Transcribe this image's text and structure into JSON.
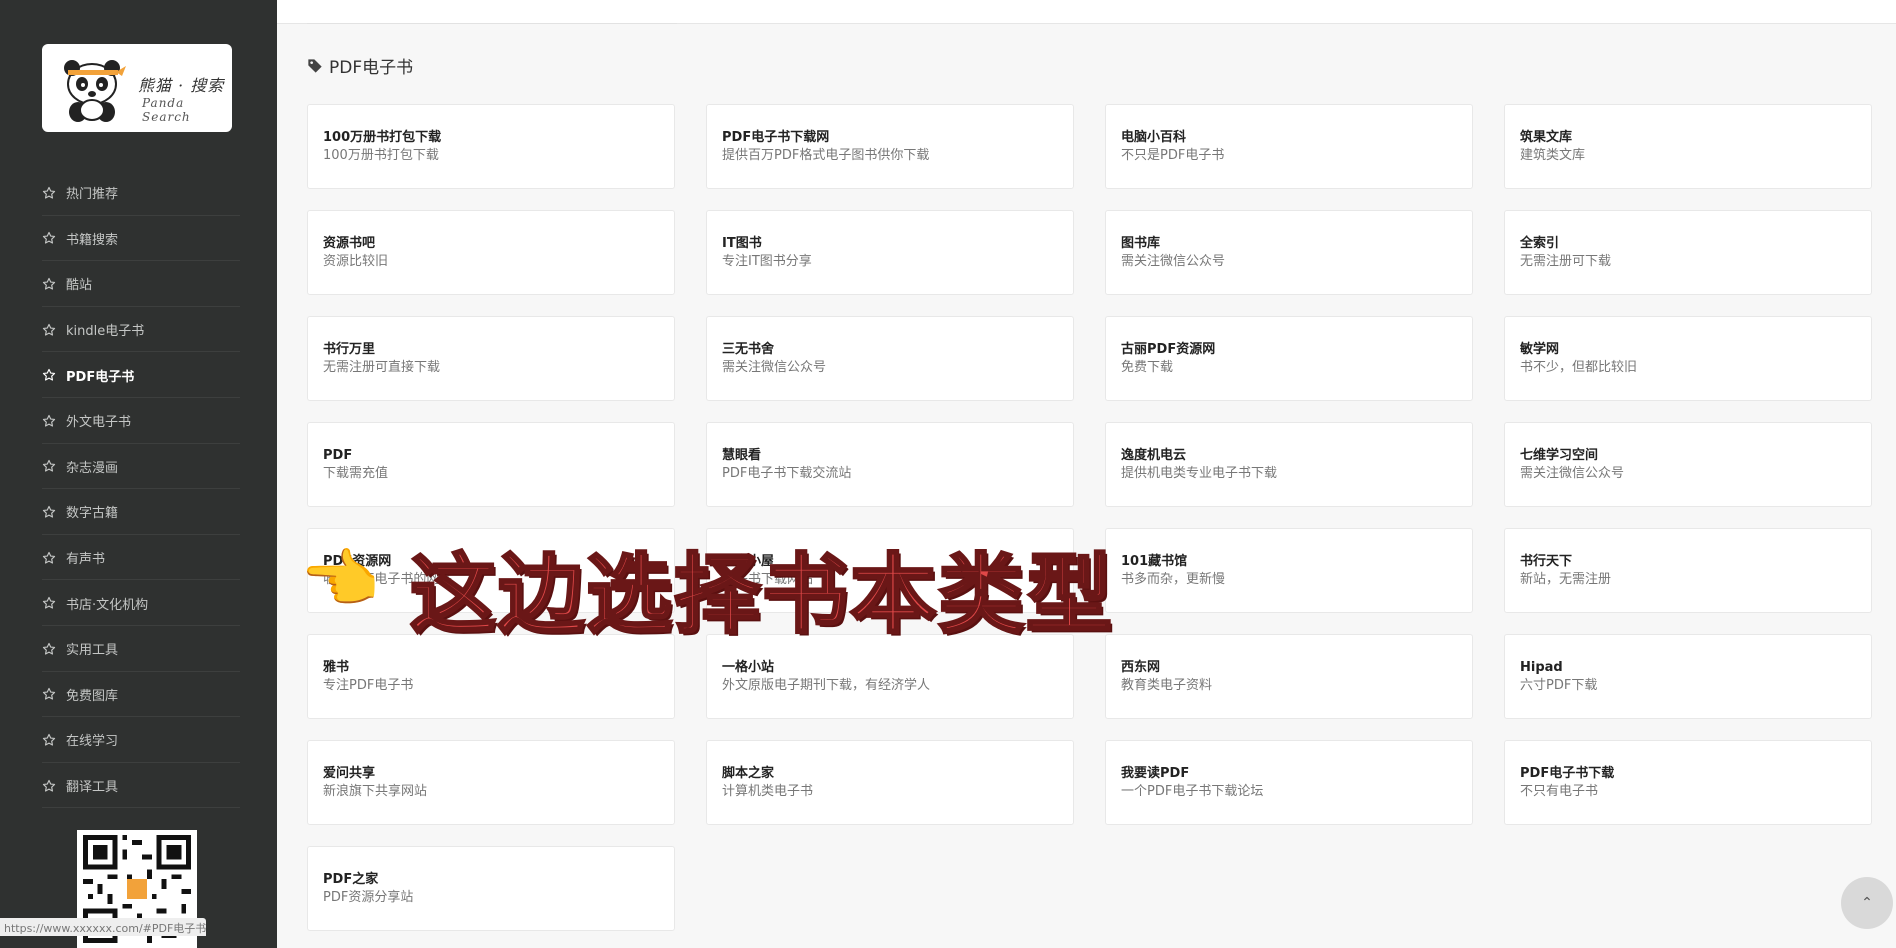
{
  "logo": {
    "title": "熊猫 · 搜索",
    "subtitle": "Panda Search"
  },
  "sidebar": {
    "items": [
      {
        "label": "热门推荐",
        "active": false
      },
      {
        "label": "书籍搜索",
        "active": false
      },
      {
        "label": "酷站",
        "active": false
      },
      {
        "label": "kindle电子书",
        "active": false
      },
      {
        "label": "PDF电子书",
        "active": true
      },
      {
        "label": "外文电子书",
        "active": false
      },
      {
        "label": "杂志漫画",
        "active": false
      },
      {
        "label": "数字古籍",
        "active": false
      },
      {
        "label": "有声书",
        "active": false
      },
      {
        "label": "书店·文化机构",
        "active": false
      },
      {
        "label": "实用工具",
        "active": false
      },
      {
        "label": "免费图库",
        "active": false
      },
      {
        "label": "在线学习",
        "active": false
      },
      {
        "label": "翻译工具",
        "active": false
      }
    ]
  },
  "status_url": "https://www.xxxxxx.com/#PDF电子书",
  "section": {
    "title": "PDF电子书",
    "icon": "tag-icon"
  },
  "cards": [
    {
      "title": "100万册书打包下载",
      "desc": "100万册书打包下载"
    },
    {
      "title": "PDF电子书下载网",
      "desc": "提供百万PDF格式电子图书供你下载"
    },
    {
      "title": "电脑小百科",
      "desc": "不只是PDF电子书"
    },
    {
      "title": "筑果文库",
      "desc": "建筑类文库"
    },
    {
      "title": "资源书吧",
      "desc": "资源比较旧"
    },
    {
      "title": "IT图书",
      "desc": "专注IT图书分享"
    },
    {
      "title": "图书库",
      "desc": "需关注微信公众号"
    },
    {
      "title": "全索引",
      "desc": "无需注册可下载"
    },
    {
      "title": "书行万里",
      "desc": "无需注册可直接下载"
    },
    {
      "title": "三无书舍",
      "desc": "需关注微信公众号"
    },
    {
      "title": "古丽PDF资源网",
      "desc": "免费下载"
    },
    {
      "title": "敏学网",
      "desc": "书不少，但都比较旧"
    },
    {
      "title": "PDF",
      "desc": "下载需充值"
    },
    {
      "title": "慧眼看",
      "desc": "PDF电子书下载交流站"
    },
    {
      "title": "逸度机电云",
      "desc": "提供机电类专业电子书下载"
    },
    {
      "title": "七维学习空间",
      "desc": "需关注微信公众号"
    },
    {
      "title": "PDF资源网",
      "desc": "收集PDF电子书的网站"
    },
    {
      "title": "书京小屋",
      "desc": "电子书下载网站"
    },
    {
      "title": "101藏书馆",
      "desc": "书多而杂，更新慢"
    },
    {
      "title": "书行天下",
      "desc": "新站，无需注册"
    },
    {
      "title": "雅书",
      "desc": "专注PDF电子书"
    },
    {
      "title": "一格小站",
      "desc": "外文原版电子期刊下载，有经济学人"
    },
    {
      "title": "西东网",
      "desc": "教育类电子资料"
    },
    {
      "title": "Hipad",
      "desc": "六寸PDF下载"
    },
    {
      "title": "爱问共享",
      "desc": "新浪旗下共享网站"
    },
    {
      "title": "脚本之家",
      "desc": "计算机类电子书"
    },
    {
      "title": "我要读PDF",
      "desc": "一个PDF电子书下载论坛"
    },
    {
      "title": "PDF电子书下载",
      "desc": "不只有电子书"
    },
    {
      "title": "PDF之家",
      "desc": "PDF资源分享站"
    }
  ],
  "overlay": {
    "text": "这边选择书本类型",
    "emoji": "👈"
  },
  "back_to_top": "⌃",
  "colors": {
    "sidebar_bg": "#2f3130",
    "overlay_red": "#e04848",
    "page_bg": "#f7f7f7"
  }
}
